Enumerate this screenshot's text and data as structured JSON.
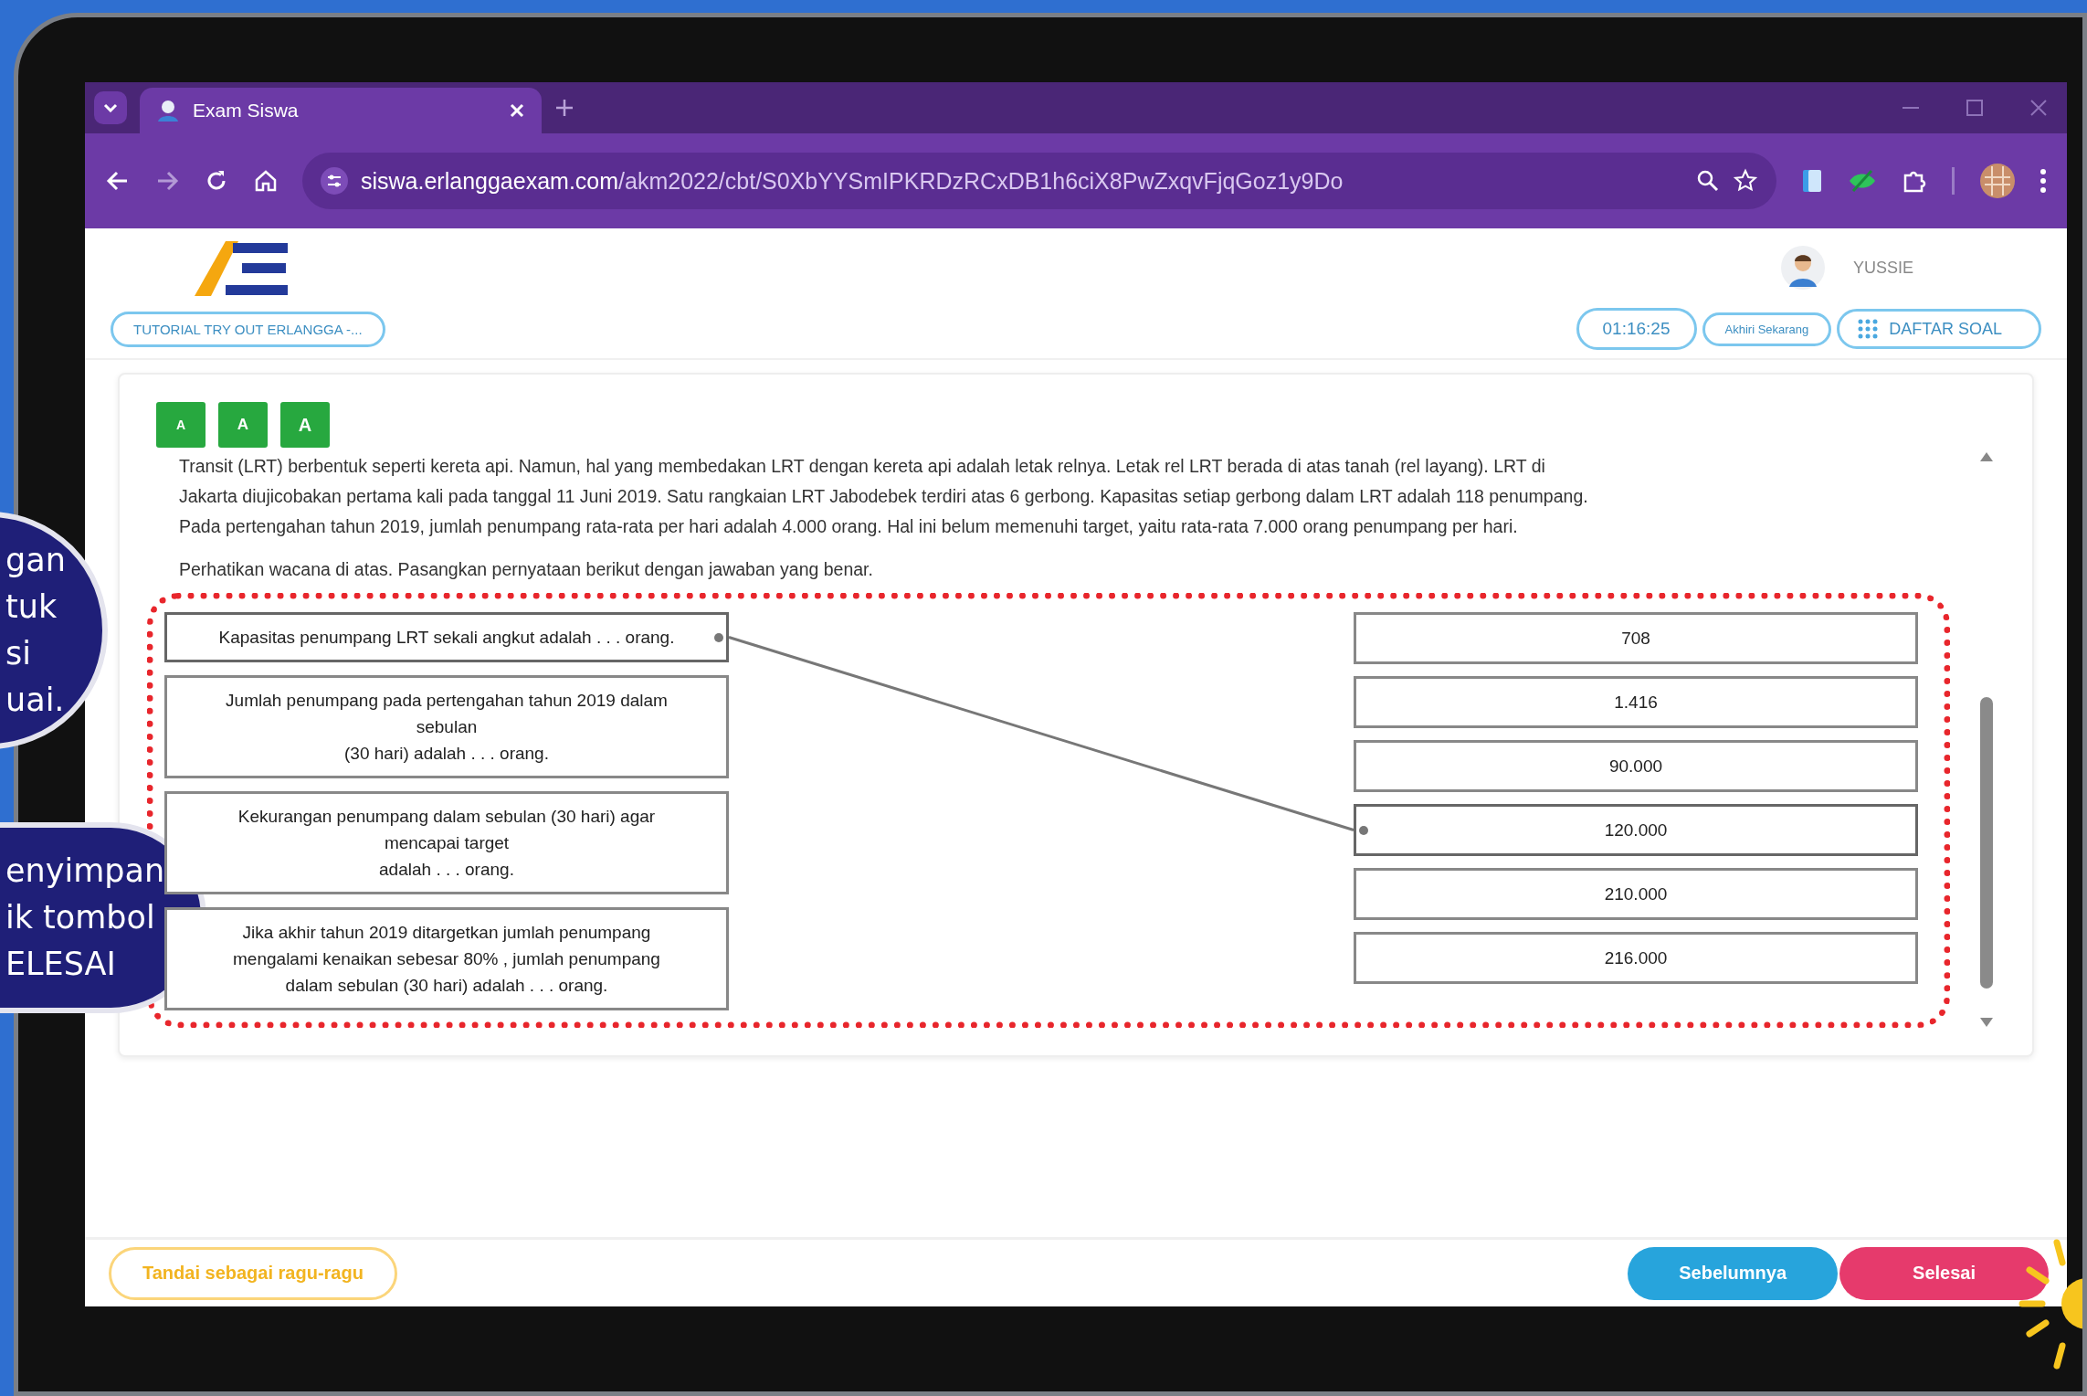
{
  "browser": {
    "tab_title": "Exam Siswa",
    "url_host": "siswa.erlanggaexam.com",
    "url_path": "/akm2022/cbt/S0XbYYSmIPKRDzRCxDB1h6ciX8PwZxqvFjqGoz1y9Do"
  },
  "header": {
    "user_name": "YUSSIE",
    "test_name": "TUTORIAL TRY OUT ERLANGGA -...",
    "timer": "01:16:25",
    "finish_now": "Akhiri Sekarang",
    "question_list": "DAFTAR SOAL"
  },
  "font_buttons": [
    "A",
    "A",
    "A"
  ],
  "passage": [
    "Transit (LRT) berbentuk seperti kereta api. Namun, hal yang membedakan LRT dengan kereta api adalah letak relnya. Letak rel LRT berada di atas tanah (rel layang). LRT di",
    "Jakarta diujicobakan pertama kali pada tanggal 11 Juni 2019. Satu rangkaian LRT Jabodebek terdiri atas 6 gerbong. Kapasitas setiap gerbong dalam LRT adalah 118 penumpang.",
    "Pada pertengahan tahun 2019, jumlah penumpang rata-rata per hari adalah 4.000 orang. Hal ini belum memenuhi target, yaitu rata-rata 7.000 orang penumpang per hari."
  ],
  "instruction": "Perhatikan wacana di atas. Pasangkan pernyataan berikut dengan jawaban yang benar.",
  "statements": [
    {
      "lines": [
        "Kapasitas penumpang LRT sekali angkut adalah . . . orang."
      ],
      "connected": true
    },
    {
      "lines": [
        "Jumlah penumpang pada pertengahan tahun 2019 dalam",
        "sebulan",
        "(30 hari) adalah . . . orang."
      ],
      "connected": false
    },
    {
      "lines": [
        "Kekurangan penumpang dalam sebulan (30 hari) agar",
        "mencapai target",
        "adalah . . . orang."
      ],
      "connected": false
    },
    {
      "lines": [
        "Jika akhir tahun 2019 ditargetkan jumlah penumpang",
        "mengalami kenaikan sebesar 80% , jumlah penumpang",
        "dalam sebulan (30 hari) adalah . . . orang."
      ],
      "connected": false
    }
  ],
  "answers": [
    {
      "label": "708",
      "connected": false
    },
    {
      "label": "1.416",
      "connected": false
    },
    {
      "label": "90.000",
      "connected": false
    },
    {
      "label": "120.000",
      "connected": true
    },
    {
      "label": "210.000",
      "connected": false
    },
    {
      "label": "216.000",
      "connected": false
    }
  ],
  "footer": {
    "doubt": "Tandai sebagai ragu-ragu",
    "previous": "Sebelumnya",
    "finish": "Selesai"
  },
  "callouts": [
    {
      "lines": [
        "gan",
        "tuk",
        "si",
        "uai."
      ]
    },
    {
      "lines": [
        "enyimpan",
        "ik tombol",
        "ELESAI"
      ]
    }
  ]
}
